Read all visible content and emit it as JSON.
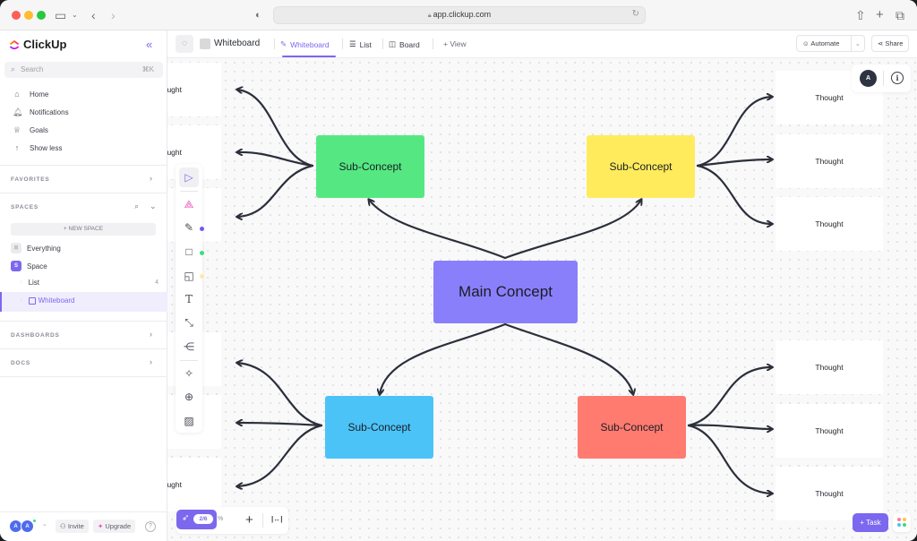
{
  "browser": {
    "url": "app.clickup.com",
    "icons": [
      "sidebar-toggle-icon",
      "back-icon",
      "forward-icon",
      "shield-icon",
      "share-icon",
      "new-tab-icon",
      "tabs-icon",
      "lock-icon",
      "reload-icon"
    ]
  },
  "sidebar": {
    "brand": "ClickUp",
    "search": {
      "placeholder": "Search",
      "shortcut": "⌘K"
    },
    "nav": [
      {
        "label": "Home",
        "icon": "home-icon"
      },
      {
        "label": "Notifications",
        "icon": "bell-icon"
      },
      {
        "label": "Goals",
        "icon": "trophy-icon"
      },
      {
        "label": "Show less",
        "icon": "arrow-up-icon"
      }
    ],
    "favorites_label": "FAVORITES",
    "spaces_label": "SPACES",
    "new_space_label": "+ NEW SPACE",
    "tree": {
      "everything": "Everything",
      "space": {
        "label": "Space",
        "badge": "S"
      },
      "list": {
        "label": "List",
        "count": "4"
      },
      "whiteboard": {
        "label": "Whiteboard"
      }
    },
    "dashboards_label": "DASHBOARDS",
    "docs_label": "DOCS",
    "footer": {
      "avatars": [
        "A",
        "A"
      ],
      "invite": "Invite",
      "upgrade": "Upgrade",
      "help": "?"
    }
  },
  "topbar": {
    "title": "Whiteboard",
    "tabs": [
      {
        "label": "Whiteboard",
        "active": true
      },
      {
        "label": "List",
        "active": false
      },
      {
        "label": "Board",
        "active": false
      },
      {
        "label": "+ View",
        "active": false
      }
    ],
    "automate": "Automate",
    "share": "Share"
  },
  "canvas": {
    "main_concept": {
      "label": "Main Concept",
      "color": "#8a7ffb"
    },
    "sub_concepts": [
      {
        "label": "Sub-Concept",
        "color": "#55e882"
      },
      {
        "label": "Sub-Concept",
        "color": "#ffeb5c"
      },
      {
        "label": "Sub-Concept",
        "color": "#4cc3f7"
      },
      {
        "label": "Sub-Concept",
        "color": "#ff7b70"
      }
    ],
    "thoughts_left": [
      "Thought",
      "Thought",
      "",
      "",
      "",
      "Thought"
    ],
    "thoughts_right": [
      "Thought",
      "Thought",
      "Thought",
      "Thought",
      "Thought",
      "Thought"
    ],
    "toolbar_tools": [
      "select-tool",
      "clickup-ai-tool",
      "pen-tool",
      "shape-tool",
      "sticky-note-tool",
      "text-tool",
      "connector-tool",
      "mind-map-tool",
      "magic-tool",
      "embed-tool",
      "image-tool"
    ],
    "tool_colors": {
      "pen": "#6b5cf0",
      "shape": "#3ddc84",
      "sticky": "#ffe9a6"
    },
    "user_avatar": "A",
    "zoom": {
      "checklist_count": "2/6",
      "percent": "%"
    },
    "task_button": "+ Task"
  }
}
